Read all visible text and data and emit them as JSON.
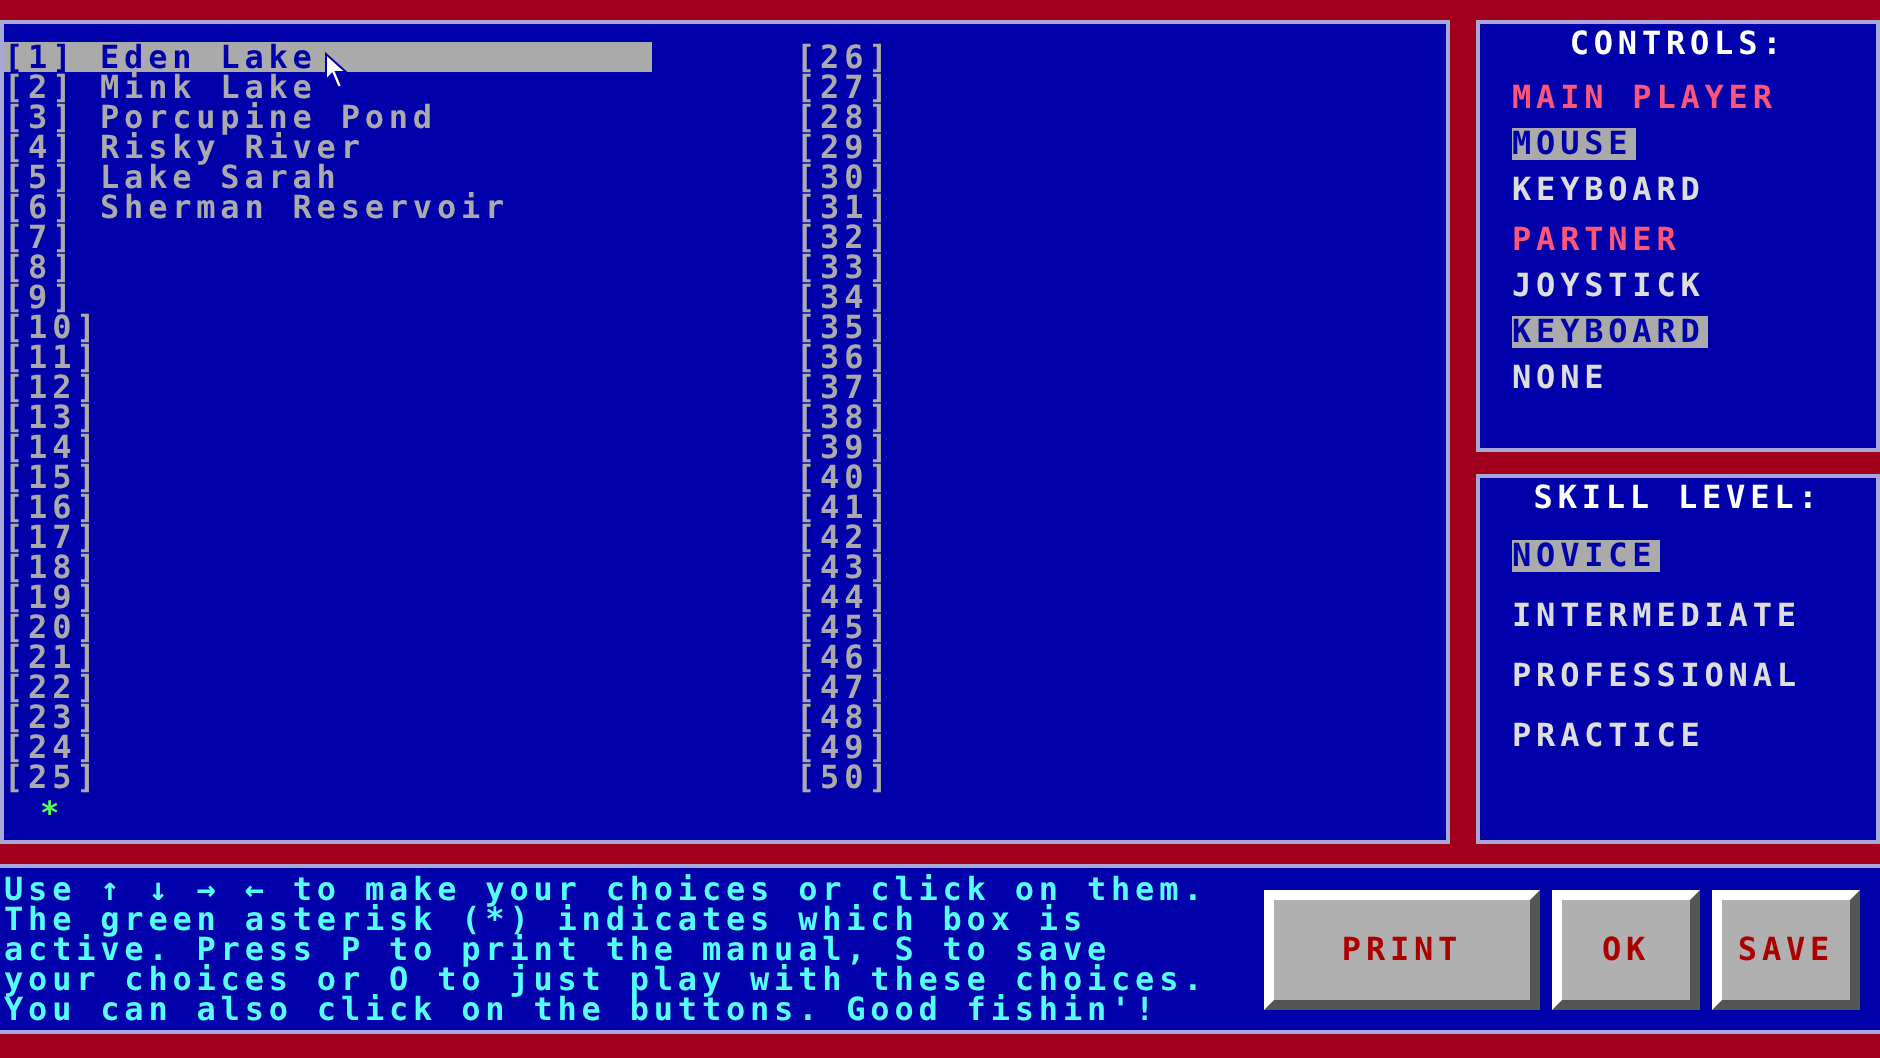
{
  "lakes": [
    {
      "number": "[1]",
      "name": "Eden Lake",
      "selected": true
    },
    {
      "number": "[2]",
      "name": "Mink Lake",
      "selected": false
    },
    {
      "number": "[3]",
      "name": "Porcupine Pond",
      "selected": false
    },
    {
      "number": "[4]",
      "name": "Risky River",
      "selected": false
    },
    {
      "number": "[5]",
      "name": "Lake Sarah",
      "selected": false
    },
    {
      "number": "[6]",
      "name": "Sherman Reservoir",
      "selected": false
    },
    {
      "number": "[7]",
      "selected": false
    },
    {
      "number": "[8]",
      "selected": false
    },
    {
      "number": "[9]",
      "selected": false
    },
    {
      "number": "[10]",
      "selected": false
    },
    {
      "number": "[11]",
      "selected": false
    },
    {
      "number": "[12]",
      "selected": false
    },
    {
      "number": "[13]",
      "selected": false
    },
    {
      "number": "[14]",
      "selected": false
    },
    {
      "number": "[15]",
      "selected": false
    },
    {
      "number": "[16]",
      "selected": false
    },
    {
      "number": "[17]",
      "selected": false
    },
    {
      "number": "[18]",
      "selected": false
    },
    {
      "number": "[19]",
      "selected": false
    },
    {
      "number": "[20]",
      "selected": false
    },
    {
      "number": "[21]",
      "selected": false
    },
    {
      "number": "[22]",
      "selected": false
    },
    {
      "number": "[23]",
      "selected": false
    },
    {
      "number": "[24]",
      "selected": false
    },
    {
      "number": "[25]",
      "selected": false
    },
    {
      "number": "[26]",
      "selected": false
    },
    {
      "number": "[27]",
      "selected": false
    },
    {
      "number": "[28]",
      "selected": false
    },
    {
      "number": "[29]",
      "selected": false
    },
    {
      "number": "[30]",
      "selected": false
    },
    {
      "number": "[31]",
      "selected": false
    },
    {
      "number": "[32]",
      "selected": false
    },
    {
      "number": "[33]",
      "selected": false
    },
    {
      "number": "[34]",
      "selected": false
    },
    {
      "number": "[35]",
      "selected": false
    },
    {
      "number": "[36]",
      "selected": false
    },
    {
      "number": "[37]",
      "selected": false
    },
    {
      "number": "[38]",
      "selected": false
    },
    {
      "number": "[39]",
      "selected": false
    },
    {
      "number": "[40]",
      "selected": false
    },
    {
      "number": "[41]",
      "selected": false
    },
    {
      "number": "[42]",
      "selected": false
    },
    {
      "number": "[43]",
      "selected": false
    },
    {
      "number": "[44]",
      "selected": false
    },
    {
      "number": "[45]",
      "selected": false
    },
    {
      "number": "[46]",
      "selected": false
    },
    {
      "number": "[47]",
      "selected": false
    },
    {
      "number": "[48]",
      "selected": false
    },
    {
      "number": "[49]",
      "selected": false
    },
    {
      "number": "[50]",
      "selected": false
    }
  ],
  "active_marker": "*",
  "controls": {
    "title": "CONTROLS:",
    "groups": [
      {
        "heading": "MAIN PLAYER",
        "options": [
          {
            "label": "MOUSE",
            "selected": true
          },
          {
            "label": "KEYBOARD",
            "selected": false
          }
        ]
      },
      {
        "heading": "PARTNER",
        "options": [
          {
            "label": "JOYSTICK",
            "selected": false
          },
          {
            "label": "KEYBOARD",
            "selected": true
          },
          {
            "label": "NONE",
            "selected": false
          }
        ]
      }
    ]
  },
  "skill_level": {
    "title": "SKILL LEVEL:",
    "options": [
      {
        "label": "NOVICE",
        "selected": true
      },
      {
        "label": "INTERMEDIATE",
        "selected": false
      },
      {
        "label": "PROFESSIONAL",
        "selected": false
      },
      {
        "label": "PRACTICE",
        "selected": false
      }
    ]
  },
  "help_lines": [
    "Use ↑ ↓ → ← to make your choices or click on them.",
    "The green asterisk (*) indicates which box is",
    "active. Press P to print the manual, S to save",
    "your choices or O to just play with these choices.",
    "You can also click on the buttons. Good fishin'!"
  ],
  "buttons": [
    "PRINT",
    "OK",
    "SAVE"
  ]
}
